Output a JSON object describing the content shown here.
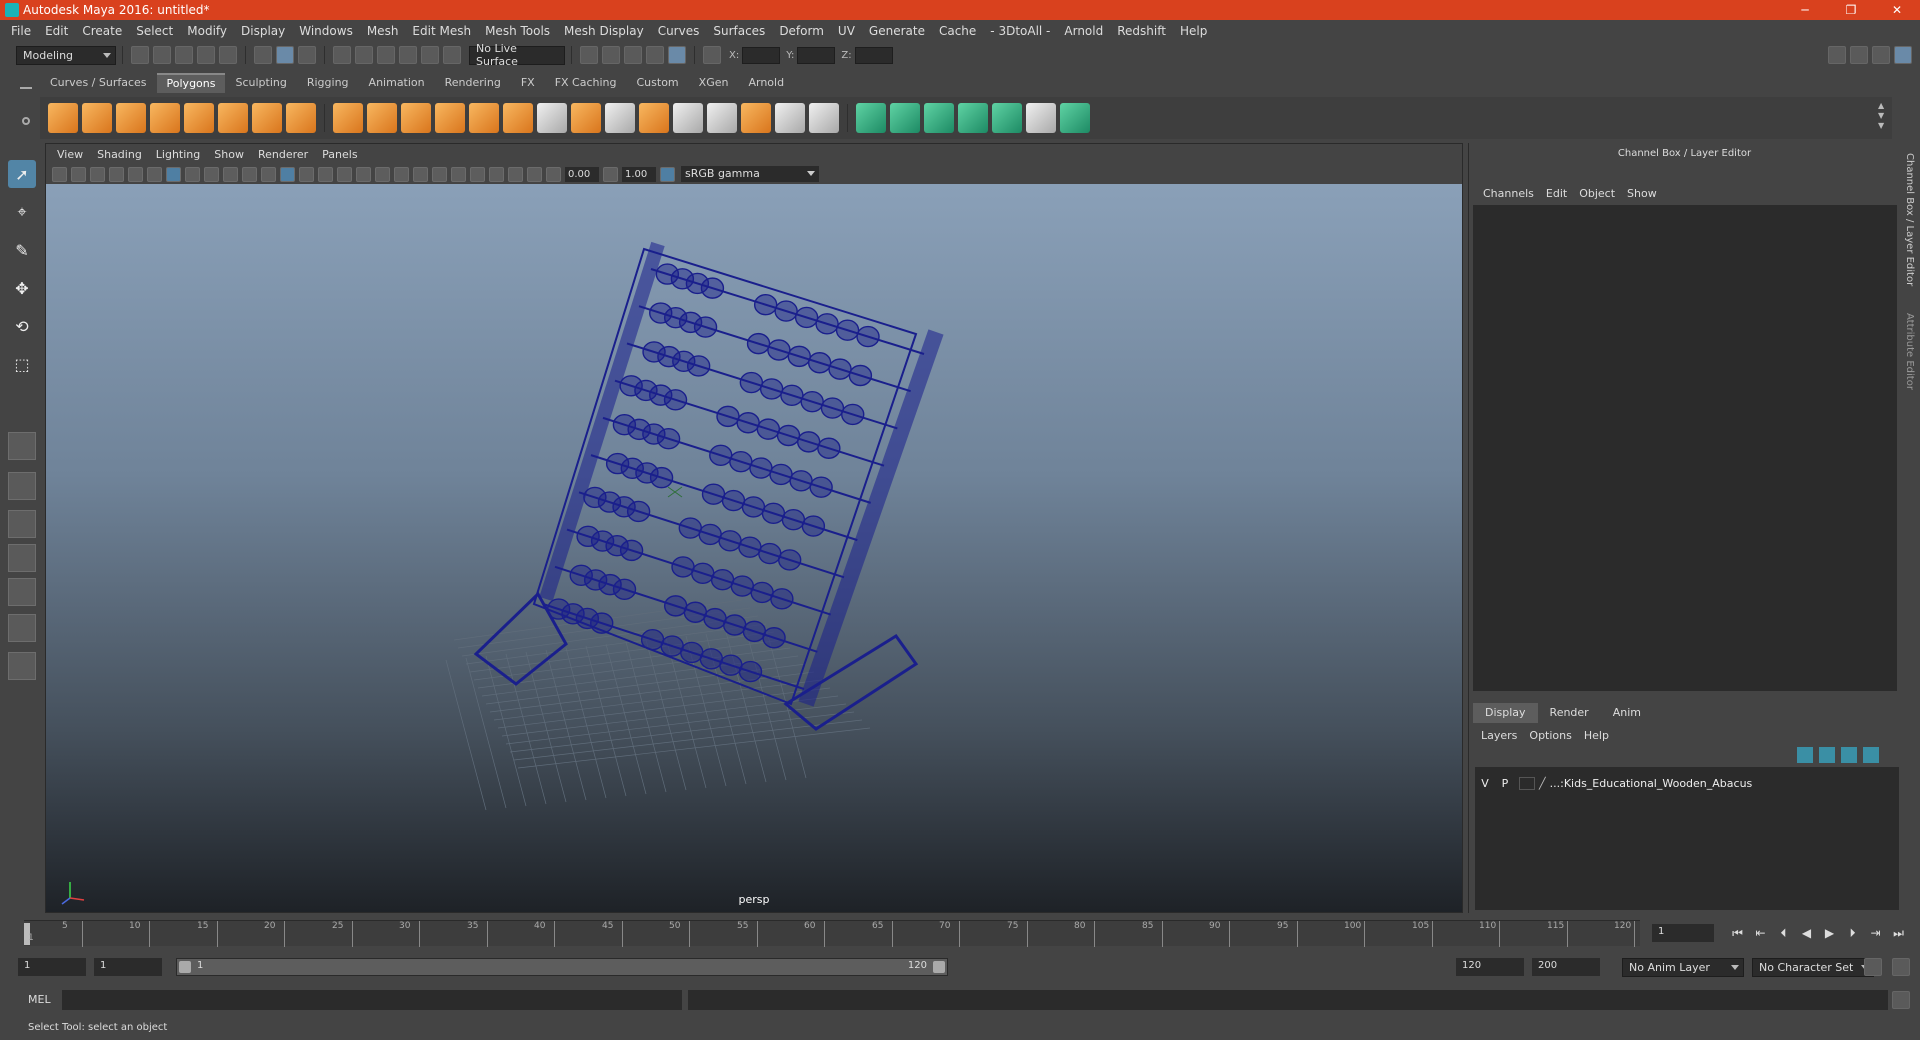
{
  "window": {
    "title": "Autodesk Maya 2016: untitled*",
    "controls": [
      "─",
      "❐",
      "✕"
    ]
  },
  "menu": [
    "File",
    "Edit",
    "Create",
    "Select",
    "Modify",
    "Display",
    "Windows",
    "Mesh",
    "Edit Mesh",
    "Mesh Tools",
    "Mesh Display",
    "Curves",
    "Surfaces",
    "Deform",
    "UV",
    "Generate",
    "Cache",
    "- 3DtoAll -",
    "Arnold",
    "Redshift",
    "Help"
  ],
  "statusline": {
    "mode": "Modeling",
    "live_surface": "No Live Surface",
    "coord_x": "X:",
    "coord_y": "Y:",
    "coord_z": "Z:"
  },
  "shelf": {
    "tabs": [
      "Curves / Surfaces",
      "Polygons",
      "Sculpting",
      "Rigging",
      "Animation",
      "Rendering",
      "FX",
      "FX Caching",
      "Custom",
      "XGen",
      "Arnold"
    ],
    "active_tab": "Polygons"
  },
  "viewport": {
    "menu": [
      "View",
      "Shading",
      "Lighting",
      "Show",
      "Renderer",
      "Panels"
    ],
    "exposure": "0.00",
    "gamma": "1.00",
    "color_space": "sRGB gamma",
    "camera": "persp",
    "wire_color": "#1a1f8c"
  },
  "channel_box": {
    "title": "Channel Box / Layer Editor",
    "menu": [
      "Channels",
      "Edit",
      "Object",
      "Show"
    ],
    "layer_tabs": [
      "Display",
      "Render",
      "Anim"
    ],
    "layer_menu": [
      "Layers",
      "Options",
      "Help"
    ],
    "layer": {
      "v": "V",
      "p": "P",
      "name": "...:Kids_Educational_Wooden_Abacus"
    },
    "side_tabs": [
      "Channel Box / Layer Editor",
      "Attribute Editor"
    ]
  },
  "timeline": {
    "ticks": [
      5,
      10,
      15,
      20,
      25,
      30,
      35,
      40,
      45,
      50,
      55,
      60,
      65,
      70,
      75,
      80,
      85,
      90,
      95,
      100,
      105,
      110,
      115,
      120
    ],
    "start_label": "1",
    "current_frame": "1",
    "max": 120
  },
  "range": {
    "start": "1",
    "playback_start": "1",
    "slider_start": "1",
    "slider_end": "120",
    "playback_end": "120",
    "end": "200",
    "anim_layer": "No Anim Layer",
    "character_set": "No Character Set"
  },
  "cmdline": {
    "label": "MEL"
  },
  "help": {
    "text": "Select Tool: select an object"
  }
}
